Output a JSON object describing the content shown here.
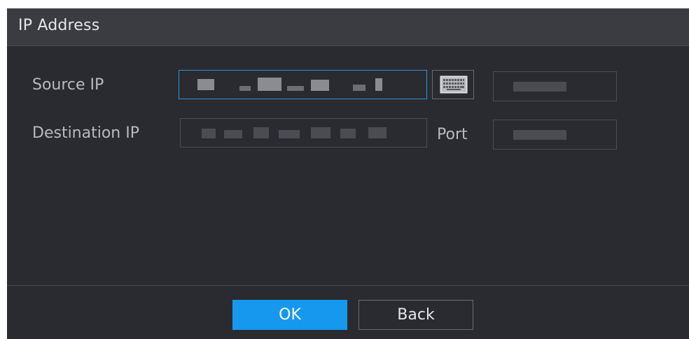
{
  "dialog": {
    "title": "IP Address"
  },
  "form": {
    "source_ip_label": "Source IP",
    "destination_ip_label": "Destination IP",
    "port_label": "Port"
  },
  "icons": {
    "keyboard": "keyboard-icon"
  },
  "buttons": {
    "ok_label": "OK",
    "back_label": "Back"
  },
  "colors": {
    "accent": "#1598ee",
    "focus_border": "#2d8fd6",
    "background": "#2a2b30"
  }
}
